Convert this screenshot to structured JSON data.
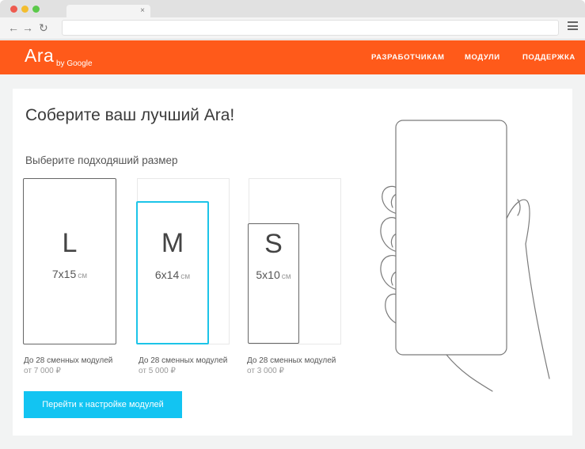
{
  "browser": {
    "tab_close": "×",
    "icons": {
      "back": "arrow-left-icon",
      "forward": "arrow-right-icon",
      "reload": "reload-icon",
      "menu": "menu-icon"
    }
  },
  "header": {
    "logo": "Ara",
    "logo_sub": "by Google",
    "nav": [
      "РАЗРАБОТЧИКАМ",
      "МОДУЛИ",
      "ПОДДЕРЖКА"
    ],
    "color": "#ff5a1a"
  },
  "main": {
    "title": "Соберите ваш лучший Ara!",
    "subtitle": "Выберите подходяший размер",
    "sizes": [
      {
        "letter": "L",
        "dims": "7x15",
        "unit": "см",
        "modules": "До 28 сменных модулей",
        "price": "от 7 000 ₽",
        "selected": false
      },
      {
        "letter": "M",
        "dims": "6x14",
        "unit": "см",
        "modules": "До 28 сменных модулей",
        "price": "от 5 000 ₽",
        "selected": true
      },
      {
        "letter": "S",
        "dims": "5x10",
        "unit": "см",
        "modules": "До 28 сменных модулей",
        "price": "от 3 000 ₽",
        "selected": false
      }
    ],
    "cta": "Перейти  к настройке модулей",
    "accent": "#12c4f2",
    "selected_color": "#1cc4e8"
  }
}
